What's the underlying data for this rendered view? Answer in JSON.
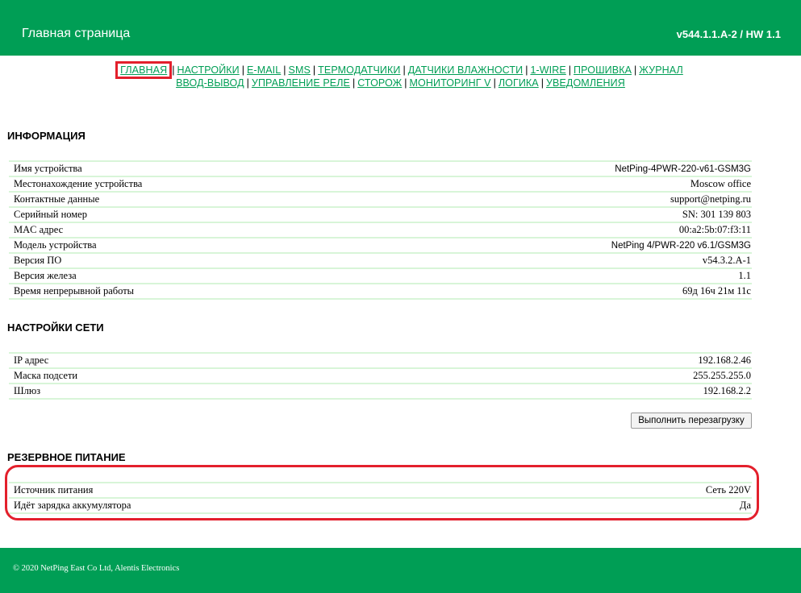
{
  "header": {
    "title": "Главная страница",
    "version": "v544.1.1.A-2 / HW 1.1"
  },
  "nav": {
    "row1": [
      "ГЛАВНАЯ",
      "НАСТРОЙКИ",
      "E-MAIL",
      "SMS",
      "ТЕРМОДАТЧИКИ",
      "ДАТЧИКИ ВЛАЖНОСТИ",
      "1-WIRE",
      "ПРОШИВКА",
      "ЖУРНАЛ"
    ],
    "row2": [
      "ВВОД-ВЫВОД",
      "УПРАВЛЕНИЕ РЕЛЕ",
      "СТОРОЖ",
      "МОНИТОРИНГ V",
      "ЛОГИКА",
      "УВЕДОМЛЕНИЯ"
    ],
    "active": "ГЛАВНАЯ",
    "separator": "|"
  },
  "info": {
    "title": "ИНФОРМАЦИЯ",
    "rows": [
      {
        "label": "Имя устройства",
        "value": "NetPing-4PWR-220-v61-GSM3G"
      },
      {
        "label": "Местонахождение устройства",
        "value": "Moscow office"
      },
      {
        "label": "Контактные данные",
        "value": "support@netping.ru"
      },
      {
        "label": "Серийный номер",
        "value": "SN: 301 139 803"
      },
      {
        "label": "MAC адрес",
        "value": "00:a2:5b:07:f3:11"
      },
      {
        "label": "Модель устройства",
        "value": "NetPing 4/PWR-220 v6.1/GSM3G"
      },
      {
        "label": "Версия ПО",
        "value": "v54.3.2.A-1"
      },
      {
        "label": "Версия железа",
        "value": "1.1"
      },
      {
        "label": "Время непрерывной работы",
        "value": "69д 16ч 21м 11с"
      }
    ]
  },
  "network": {
    "title": "НАСТРОЙКИ СЕТИ",
    "rows": [
      {
        "label": "IP адрес",
        "value": "192.168.2.46"
      },
      {
        "label": "Маска подсети",
        "value": "255.255.255.0"
      },
      {
        "label": "Шлюз",
        "value": "192.168.2.2"
      }
    ],
    "reboot_label": "Выполнить перезагрузку"
  },
  "backup_power": {
    "title": "РЕЗЕРВНОЕ ПИТАНИЕ",
    "rows": [
      {
        "label": "Источник питания",
        "value": "Сеть 220V"
      },
      {
        "label": "Идёт зарядка аккумулятора",
        "value": "Да"
      }
    ]
  },
  "footer": {
    "copyright": "© 2020 NetPing East Co Ltd, Alentis Electronics"
  },
  "colors": {
    "brand_green": "#009e55",
    "row_border": "#d8f5d8",
    "highlight_red": "#e3202c"
  }
}
